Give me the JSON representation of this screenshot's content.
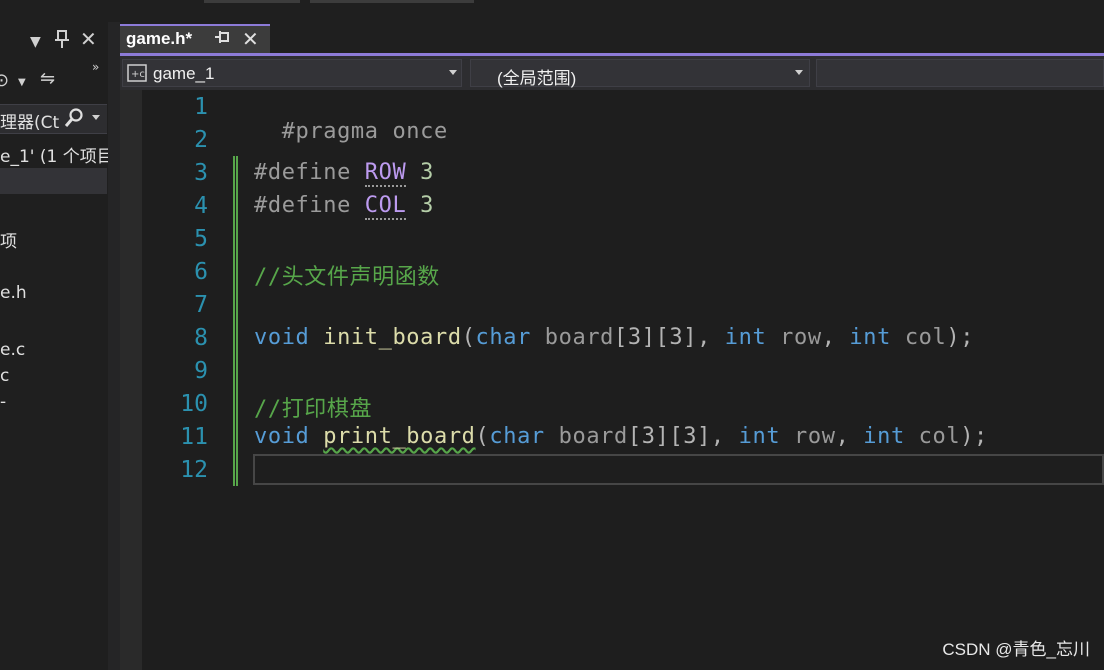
{
  "left_panel": {
    "header_icons": [
      "chevron-down-icon",
      "pin-icon",
      "close-icon"
    ],
    "toolbar_icons": [
      "history-icon",
      "dropdown-icon",
      "sync-icon",
      "overflow-icon"
    ],
    "search_placeholder": "理器(Ct",
    "solution_label": "e_1' (1 个项目",
    "items": [
      "项",
      "e.h",
      "e.c",
      "c",
      "-"
    ]
  },
  "tab": {
    "title": "game.h*"
  },
  "navbar": {
    "project": "game_1",
    "scope": "(全局范围)"
  },
  "editor": {
    "line_numbers": [
      "1",
      "2",
      "3",
      "4",
      "5",
      "6",
      "7",
      "8",
      "9",
      "10",
      "11",
      "12"
    ],
    "tokens": {
      "l1_pp": "#pragma once",
      "l3_pp": "#define ",
      "l3_macro": "ROW",
      "l3_num": " 3",
      "l4_pp": "#define ",
      "l4_macro": "COL",
      "l4_num": " 3",
      "l6_cm": "//头文件声明函数",
      "l8_kw": "void ",
      "l8_fn": "init_board",
      "l8_p1": "(",
      "l8_char": "char",
      "l8_board": " board",
      "l8_dims": "[3][3], ",
      "l8_int1": "int",
      "l8_row": " row",
      "l8_c1": ", ",
      "l8_int2": "int",
      "l8_col": " col",
      "l8_end": ");",
      "l10_cm": "//打印棋盘",
      "l11_kw": "void ",
      "l11_fn": "print_board",
      "l11_p1": "(",
      "l11_char": "char",
      "l11_board": " board",
      "l11_dims": "[3][3], ",
      "l11_int1": "int",
      "l11_row": " row",
      "l11_c1": ", ",
      "l11_int2": "int",
      "l11_col": " col",
      "l11_end": ");"
    }
  },
  "watermark": "CSDN @青色_忘川",
  "colors": {
    "accent": "#8d7bd8",
    "line_number": "#2b91af",
    "keyword": "#569cd6",
    "comment": "#57a64a",
    "macro": "#bd9bf0",
    "function": "#dcdcaa"
  }
}
